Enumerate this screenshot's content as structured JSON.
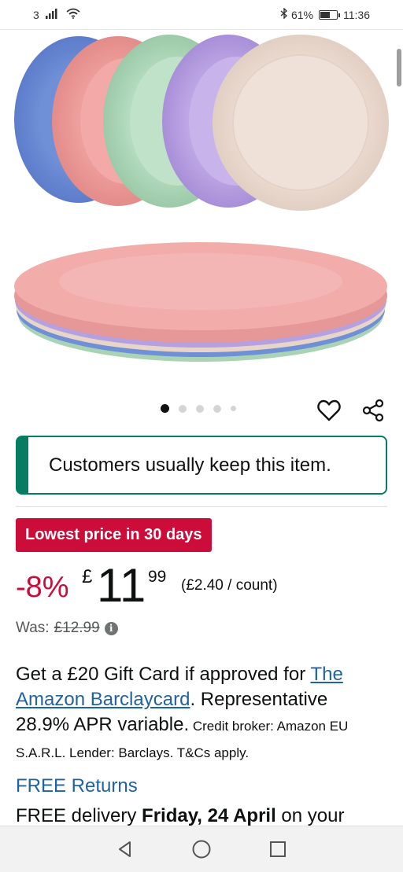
{
  "status_bar": {
    "signal_label": "3",
    "battery_percent": "61%",
    "battery_level": 0.61,
    "time": "11:36",
    "icons": [
      "signal-icon",
      "wifi-icon",
      "bluetooth-icon",
      "battery-icon"
    ]
  },
  "product": {
    "image_alt": "Set of coloured plates",
    "plate_colors": [
      "#6f8fd6",
      "#e99a9a",
      "#a9d3b4",
      "#b5a0e0",
      "#ead7cc"
    ],
    "carousel": {
      "count": 5,
      "active_index": 0
    }
  },
  "notice": {
    "text": "Customers usually keep this item.",
    "accent_color": "#067d62"
  },
  "deal": {
    "badge": "Lowest price in 30 days",
    "badge_color": "#cc0c39"
  },
  "price": {
    "discount": "-8%",
    "currency": "£",
    "whole": "11",
    "fraction": "99",
    "unit_price": "(£2.40 / count)",
    "was_label": "Was:",
    "was_price": "£12.99"
  },
  "gift": {
    "intro": "Get a £20 Gift Card if approved for ",
    "link": "The Amazon Barclaycard",
    "middle": ". Representative 28.9% APR variable.",
    "small": " Credit broker: Amazon EU S.A.R.L. Lender: Barclays. T&Cs apply."
  },
  "returns": {
    "label": "FREE Returns"
  },
  "delivery": {
    "prefix": "FREE delivery ",
    "date": "Friday, 24 April",
    "suffix": " on your"
  },
  "nav": {
    "icons": [
      "back-icon",
      "home-icon",
      "recents-icon"
    ]
  }
}
